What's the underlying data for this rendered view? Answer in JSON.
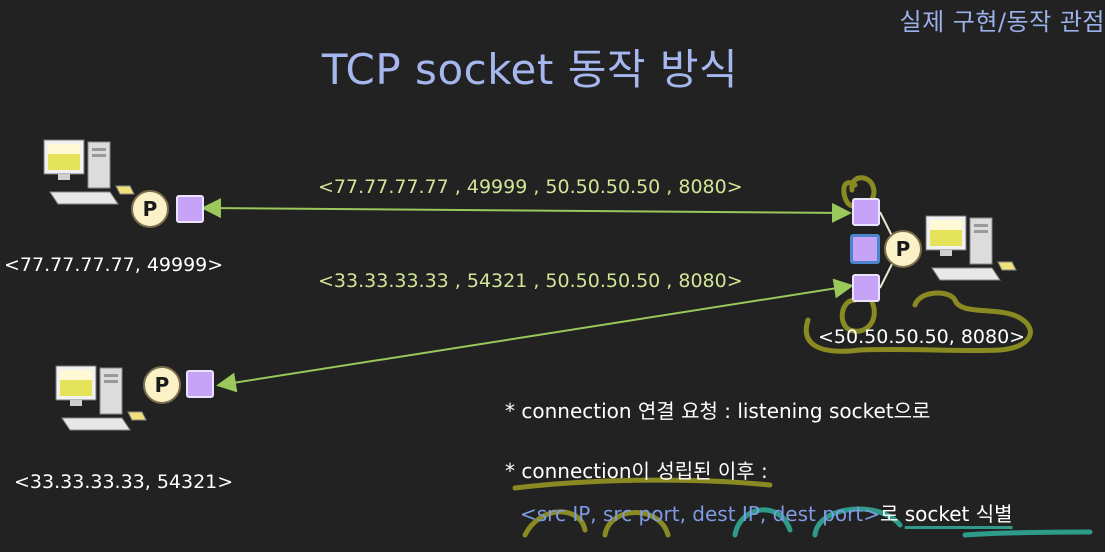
{
  "corner_text": "실제 구현/동작 관점",
  "title": "TCP socket 동작 방식",
  "connections": [
    {
      "label": "<77.77.77.77 , 49999 , 50.50.50.50 , 8080>"
    },
    {
      "label": "<33.33.33.33 , 54321 , 50.50.50.50 , 8080>"
    }
  ],
  "clients": [
    {
      "address": "<77.77.77.77, 49999>",
      "process": "P"
    },
    {
      "address": "<33.33.33.33, 54321>",
      "process": "P"
    }
  ],
  "server": {
    "address": "<50.50.50.50, 8080>",
    "process": "P"
  },
  "notes": {
    "line1": "* connection 연결 요청 : listening socket으로",
    "line2": "* connection이 성립된 이후 :",
    "tuple_open": "<",
    "tuple_fields": [
      "src IP",
      "src port",
      "dest IP",
      "dest port"
    ],
    "tuple_sep": ", ",
    "tuple_close": ">",
    "tuple_suffix": "로 ",
    "socket_word": "socket 식별"
  },
  "colors": {
    "background": "#222223",
    "title": "#a5b7ee",
    "connection_label": "#d2e596",
    "arrow": "#9ac85a",
    "socket": "#c6a3f6",
    "listening_border": "#4b86cf",
    "process_circle": "#fbf1c6",
    "annotation_olive": "#8a8a22",
    "annotation_teal": "#2f9b8a"
  },
  "icons": {
    "computer": "desktop-computer-icon",
    "process": "process-circle",
    "socket": "socket-square"
  }
}
